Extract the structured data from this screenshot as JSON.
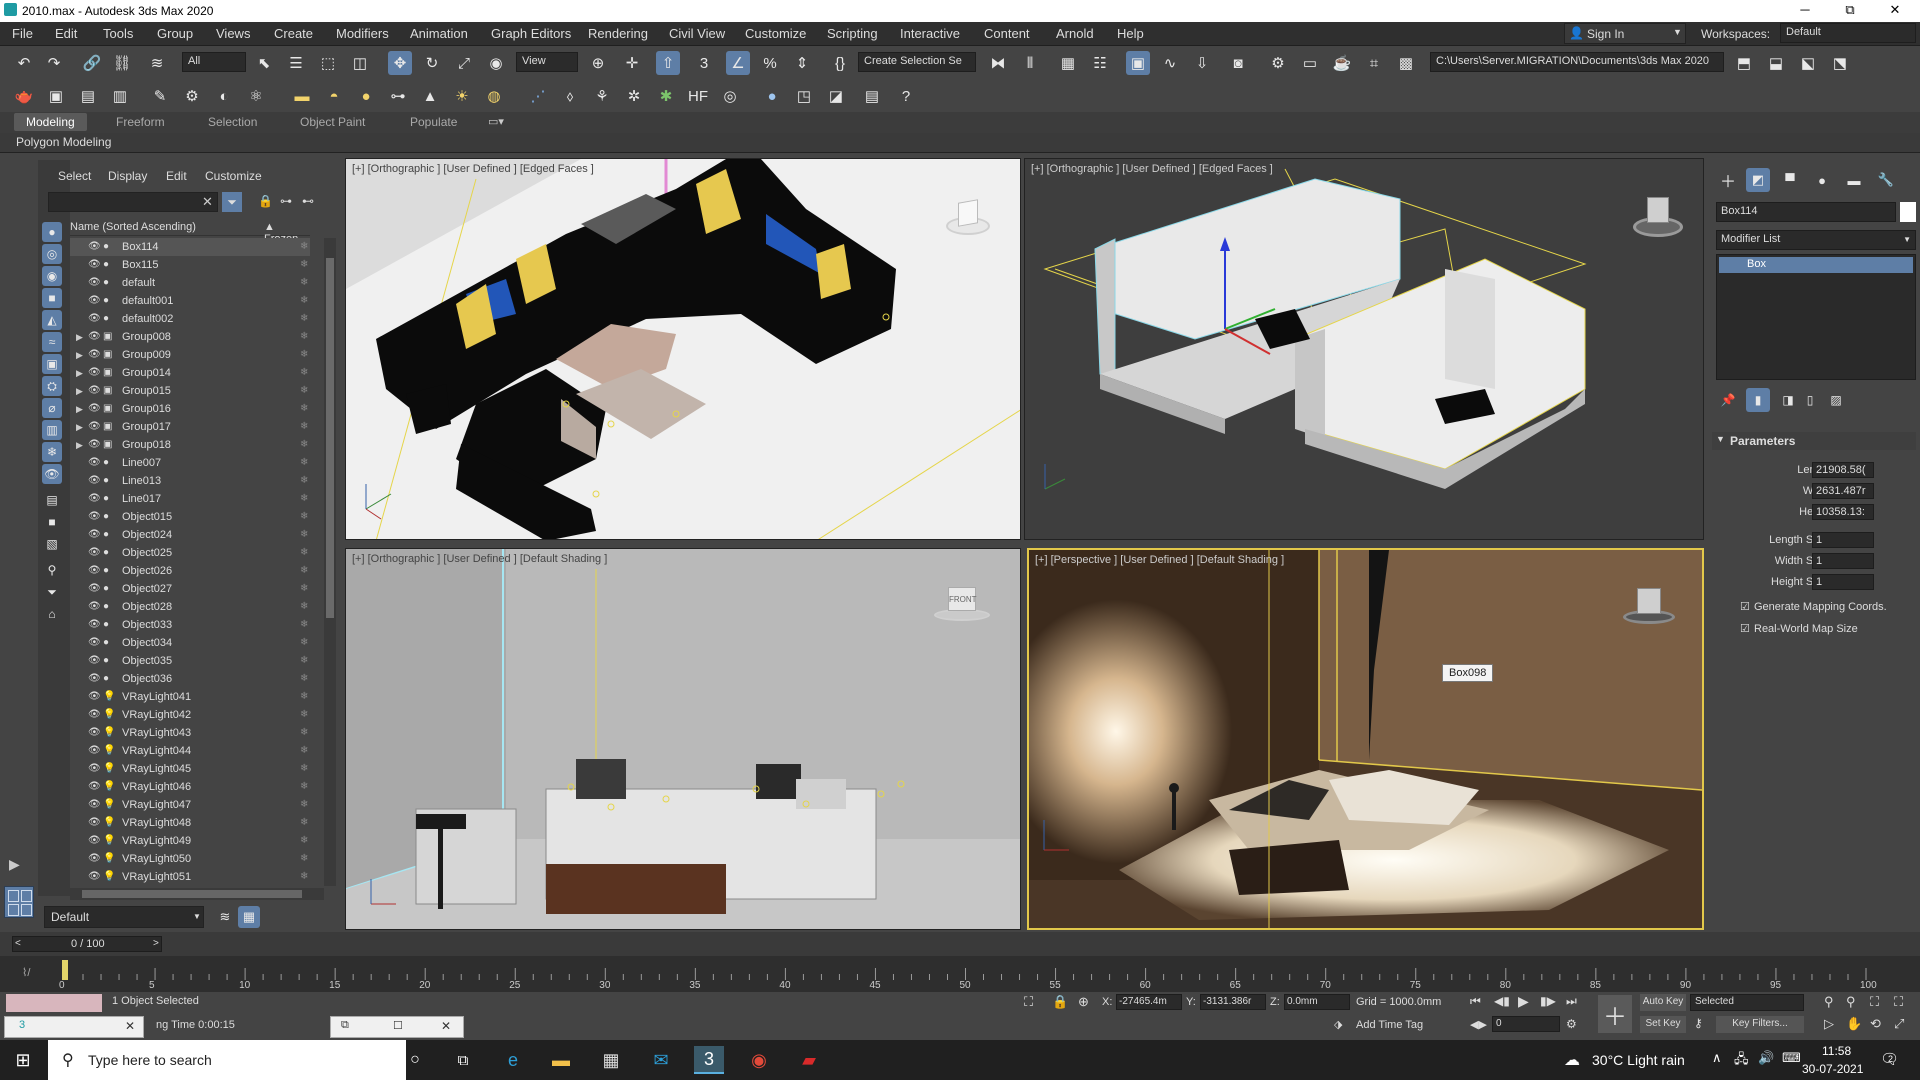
{
  "window": {
    "title": "2010.max - Autodesk 3ds Max 2020",
    "minimize": "─",
    "maximize": "⧉",
    "close": "✕"
  },
  "menus": [
    "File",
    "Edit",
    "Tools",
    "Group",
    "Views",
    "Create",
    "Modifiers",
    "Animation",
    "Graph Editors",
    "Rendering",
    "Civil View",
    "Customize",
    "Scripting",
    "Interactive",
    "Content",
    "Arnold",
    "Help"
  ],
  "signin": {
    "label": "Sign In",
    "workspaces_label": "Workspaces:",
    "workspace": "Default"
  },
  "toolbar": {
    "selection_filter": "All",
    "ref_coord": "View",
    "named_selection": "Create Selection Se",
    "project_path": "C:\\Users\\Server.MIGRATION\\Documents\\3ds Max 2020"
  },
  "ribbon": {
    "tabs": [
      "Modeling",
      "Freeform",
      "Selection",
      "Object Paint",
      "Populate"
    ],
    "active": "Modeling",
    "sub": "Polygon Modeling"
  },
  "explorer": {
    "menus": [
      "Select",
      "Display",
      "Edit",
      "Customize"
    ],
    "col_name": "Name (Sorted Ascending)",
    "col_frozen": "▲ Frozen",
    "items": [
      {
        "name": "Box114",
        "expand": "",
        "sel": true
      },
      {
        "name": "Box115",
        "expand": ""
      },
      {
        "name": "default",
        "expand": ""
      },
      {
        "name": "default001",
        "expand": ""
      },
      {
        "name": "default002",
        "expand": ""
      },
      {
        "name": "Group008",
        "expand": "▶"
      },
      {
        "name": "Group009",
        "expand": "▶"
      },
      {
        "name": "Group014",
        "expand": "▶"
      },
      {
        "name": "Group015",
        "expand": "▶"
      },
      {
        "name": "Group016",
        "expand": "▶"
      },
      {
        "name": "Group017",
        "expand": "▶"
      },
      {
        "name": "Group018",
        "expand": "▶"
      },
      {
        "name": "Line007",
        "expand": ""
      },
      {
        "name": "Line013",
        "expand": ""
      },
      {
        "name": "Line017",
        "expand": ""
      },
      {
        "name": "Object015",
        "expand": ""
      },
      {
        "name": "Object024",
        "expand": ""
      },
      {
        "name": "Object025",
        "expand": ""
      },
      {
        "name": "Object026",
        "expand": ""
      },
      {
        "name": "Object027",
        "expand": ""
      },
      {
        "name": "Object028",
        "expand": ""
      },
      {
        "name": "Object033",
        "expand": ""
      },
      {
        "name": "Object034",
        "expand": ""
      },
      {
        "name": "Object035",
        "expand": ""
      },
      {
        "name": "Object036",
        "expand": ""
      },
      {
        "name": "VRayLight041",
        "expand": ""
      },
      {
        "name": "VRayLight042",
        "expand": ""
      },
      {
        "name": "VRayLight043",
        "expand": ""
      },
      {
        "name": "VRayLight044",
        "expand": ""
      },
      {
        "name": "VRayLight045",
        "expand": ""
      },
      {
        "name": "VRayLight046",
        "expand": ""
      },
      {
        "name": "VRayLight047",
        "expand": ""
      },
      {
        "name": "VRayLight048",
        "expand": ""
      },
      {
        "name": "VRayLight049",
        "expand": ""
      },
      {
        "name": "VRayLight050",
        "expand": ""
      },
      {
        "name": "VRayLight051",
        "expand": ""
      }
    ],
    "layer": "Default"
  },
  "viewports": {
    "top_left": "[+] [Orthographic ] [User Defined ] [Edged Faces ]",
    "top_right": "[+] [Orthographic ] [User Defined ] [Edged Faces ]",
    "bottom_left": "[+] [Orthographic ] [User Defined ] [Default Shading ]",
    "bottom_right": "[+] [Perspective ] [User Defined ] [Default Shading ]",
    "tooltip": "Box098",
    "viewcube_front": "FRONT"
  },
  "command_panel": {
    "object_name": "Box114",
    "modifier_list": "Modifier List",
    "stack_item": "Box",
    "rollout": "Parameters",
    "params": [
      {
        "label": "Length:",
        "value": "21908.58("
      },
      {
        "label": "Width:",
        "value": "2631.487r"
      },
      {
        "label": "Height:",
        "value": "10358.13:"
      },
      {
        "label": "Length Segs:",
        "value": "1"
      },
      {
        "label": "Width Segs:",
        "value": "1"
      },
      {
        "label": "Height Segs:",
        "value": "1"
      }
    ],
    "gen_mapping": "Generate Mapping Coords.",
    "real_world": "Real-World Map Size"
  },
  "timeline": {
    "frame": "0 / 100",
    "ticks": [
      "0",
      "5",
      "10",
      "15",
      "20",
      "25",
      "30",
      "35",
      "40",
      "45",
      "50",
      "55",
      "60",
      "65",
      "70",
      "75",
      "80",
      "85",
      "90",
      "95",
      "100"
    ],
    "current_frame_pct": 0
  },
  "status": {
    "selected": "1 Object Selected",
    "render_time": "ng Time  0:00:15",
    "x_label": "X:",
    "x": "-27465.4m",
    "y_label": "Y:",
    "y": "-3131.386r",
    "z_label": "Z:",
    "z": "0.0mm",
    "grid": "Grid = 1000.0mm",
    "add_time_tag": "Add Time Tag",
    "frame_field": "0",
    "auto_key": "Auto Key",
    "set_key": "Set Key",
    "key_mode": "Selected",
    "key_filters": "Key Filters..."
  },
  "taskbar": {
    "search_placeholder": "Type here to search",
    "weather": "30°C  Light rain",
    "time": "11:58",
    "date": "30-07-2021",
    "notifications": "2"
  },
  "colors": {
    "accent": "#5e7ea6",
    "selection_yellow": "#e2c84a",
    "sofa_blue": "#2256b8",
    "pillow_yellow": "#e6c84f"
  }
}
